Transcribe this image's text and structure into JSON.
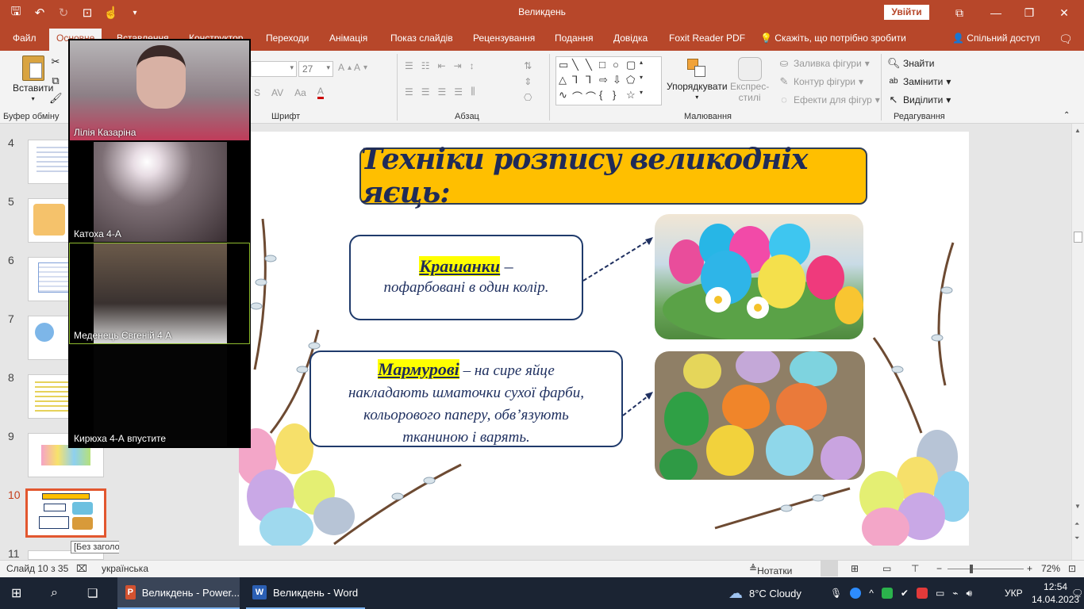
{
  "app": {
    "window_title": "Великдень",
    "sign_in_label": "Увійти",
    "qat_icons": [
      "save-icon",
      "undo-icon",
      "redo-icon",
      "present-icon",
      "touch-mode-icon",
      "customize-icon"
    ],
    "window_buttons": [
      "minimize-icon",
      "restore-icon",
      "close-icon"
    ]
  },
  "tabs": [
    {
      "label": "Файл"
    },
    {
      "label": "Основне"
    },
    {
      "label": "Вставлення"
    },
    {
      "label": "Конструктор"
    },
    {
      "label": "Переходи"
    },
    {
      "label": "Анімація"
    },
    {
      "label": "Показ слайдів"
    },
    {
      "label": "Рецензування"
    },
    {
      "label": "Подання"
    },
    {
      "label": "Довідка"
    },
    {
      "label": "Foxit Reader PDF"
    }
  ],
  "tell_me": "Скажіть, що потрібно зробити",
  "share_label": "Спільний доступ",
  "ribbon": {
    "paste_label": "Вставити",
    "groups": {
      "clipboard": "Буфер обміну",
      "font": "Шрифт",
      "paragraph": "Абзац",
      "drawing": "Малювання",
      "editing": "Редагування"
    },
    "font_size": "27",
    "arrange_label": "Упорядкувати",
    "quick_styles_label_1": "Експрес-",
    "quick_styles_label_2": "стилі",
    "shape_fill": "Заливка фігури",
    "shape_outline": "Контур фігури",
    "shape_effects": "Ефекти для фігур",
    "find": "Знайти",
    "replace": "Замінити",
    "select": "Виділити"
  },
  "thumbnails": [
    {
      "num": "4"
    },
    {
      "num": "5"
    },
    {
      "num": "6"
    },
    {
      "num": "7"
    },
    {
      "num": "8"
    },
    {
      "num": "9"
    },
    {
      "num": "10"
    },
    {
      "num": "11"
    }
  ],
  "thumb_tooltip": "[Без заголовка]",
  "video": {
    "participants": [
      {
        "name": "Лілія Казаріна"
      },
      {
        "name": "Катоха 4-А"
      },
      {
        "name": "Меденець Євгеній 4 А"
      },
      {
        "name": "Кирюха 4-А впустите"
      }
    ]
  },
  "slide": {
    "title": "Техніки розпису великодніх яєць:",
    "box1": {
      "term": "Крашанки",
      "dash": " –",
      "desc": "пофарбовані в один колір."
    },
    "box2": {
      "term": "Мармурові",
      "line1": " – на сире яйце",
      "line2": "накладають шматочки сухої фарби,",
      "line3": "кольорового паперу, обв’язують",
      "line4": "тканиною і варять."
    }
  },
  "status": {
    "slide_counter": "Слайд 10 з 35",
    "language": "українська",
    "notes": "Нотатки",
    "zoom": "72%"
  },
  "taskbar": {
    "apps": [
      {
        "label": "Великдень - Power..."
      },
      {
        "label": "Великдень - Word"
      }
    ],
    "weather": "8°C  Cloudy",
    "lang": "УКР",
    "time": "12:54",
    "date": "14.04.2023"
  }
}
